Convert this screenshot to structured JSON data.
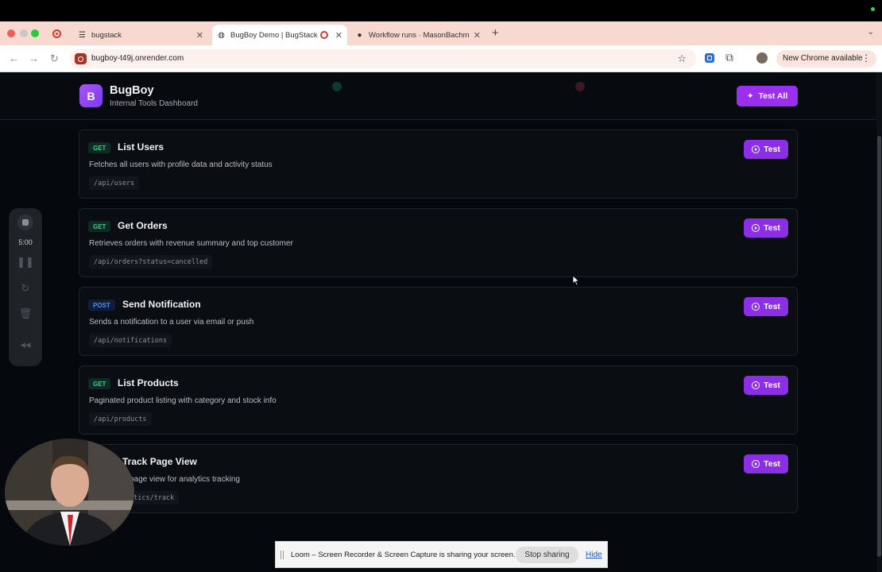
{
  "browser": {
    "tabs": [
      {
        "title": "bugstack"
      },
      {
        "title": "BugBoy Demo | BugStack"
      },
      {
        "title": "Workflow runs · MasonBachm"
      }
    ],
    "url": "bugboy-t49j.onrender.com",
    "update_label": "New Chrome available"
  },
  "app": {
    "logo_letter": "B",
    "title": "BugBoy",
    "subtitle": "Internal Tools Dashboard",
    "test_all_label": "Test All",
    "test_label": "Test"
  },
  "endpoints": [
    {
      "method": "GET",
      "name": "List Users",
      "description": "Fetches all users with profile data and activity status",
      "path": "/api/users"
    },
    {
      "method": "GET",
      "name": "Get Orders",
      "description": "Retrieves orders with revenue summary and top customer",
      "path": "/api/orders?status=cancelled"
    },
    {
      "method": "POST",
      "name": "Send Notification",
      "description": "Sends a notification to a user via email or push",
      "path": "/api/notifications"
    },
    {
      "method": "GET",
      "name": "List Products",
      "description": "Paginated product listing with category and stock info",
      "path": "/api/products"
    },
    {
      "method": "",
      "name": "Track Page View",
      "description": "page view for analytics tracking",
      "path": "ytics/track"
    }
  ],
  "loom": {
    "timer": "5:00",
    "share_message": "Loom – Screen Recorder & Screen Capture is sharing your screen.",
    "stop_sharing_label": "Stop sharing",
    "hide_label": "Hide"
  },
  "colors": {
    "accent": "#9b2ff0",
    "get_badge": "#37c98a",
    "post_badge": "#4d8ff0",
    "page_bg": "#05080c"
  }
}
